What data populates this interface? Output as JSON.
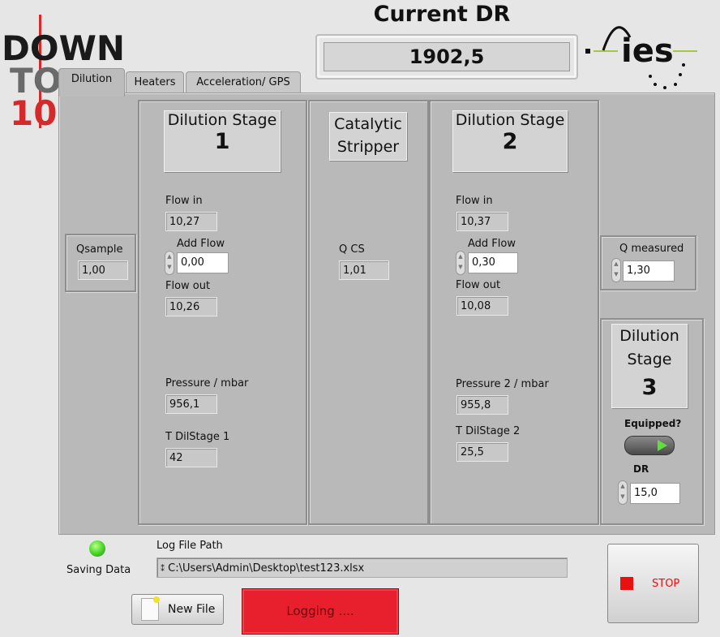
{
  "logo_left": {
    "lines": [
      "DOWN",
      "TO",
      "10"
    ],
    "colors": {
      "line1": "#1a1a1a",
      "line2": "#6a6a6a",
      "line3": "#d42a2a"
    }
  },
  "logo_right": {
    "text": "ies",
    "accent": "#a4c64a"
  },
  "header": {
    "title": "Current DR",
    "current_dr": "1902,5"
  },
  "tabs": [
    {
      "label": "Dilution",
      "active": true
    },
    {
      "label": "Heaters"
    },
    {
      "label": "Acceleration/ GPS"
    }
  ],
  "qsample": {
    "label": "Qsample",
    "value": "1,00"
  },
  "stage1": {
    "title": "Dilution Stage",
    "number": "1",
    "flow_in_label": "Flow  in",
    "flow_in": "10,27",
    "add_flow_label": "Add Flow",
    "add_flow": "0,00",
    "flow_out_label": "Flow  out",
    "flow_out": "10,26",
    "pressure_label": "Pressure / mbar",
    "pressure": "956,1",
    "temp_label": "T DilStage 1",
    "temp": "42"
  },
  "catalytic": {
    "title_line1": "Catalytic",
    "title_line2": "Stripper",
    "qcs_label": "Q CS",
    "qcs": "1,01"
  },
  "stage2": {
    "title": "Dilution Stage",
    "number": "2",
    "flow_in_label": "Flow in",
    "flow_in": "10,37",
    "add_flow_label": "Add Flow",
    "add_flow": "0,30",
    "flow_out_label": "Flow out",
    "flow_out": "10,08",
    "pressure_label": "Pressure 2 / mbar",
    "pressure": "955,8",
    "temp_label": "T DilStage 2",
    "temp": "25,5"
  },
  "qmeasured": {
    "label": "Q measured",
    "value": "1,30"
  },
  "stage3": {
    "title_line1": "Dilution",
    "title_line2": "Stage",
    "number": "3",
    "equipped_label": "Equipped?",
    "equipped": true,
    "dr_label": "DR",
    "dr": "15,0"
  },
  "footer": {
    "saving_label": "Saving Data",
    "saving_led": "#4cd82a",
    "log_path_label": "Log File Path",
    "log_path": "C:\\Users\\Admin\\Desktop\\test123.xlsx",
    "new_file_label": "New File",
    "logging_label": "Logging ....",
    "logging_color": "#e8202e",
    "stop_label": "STOP"
  }
}
